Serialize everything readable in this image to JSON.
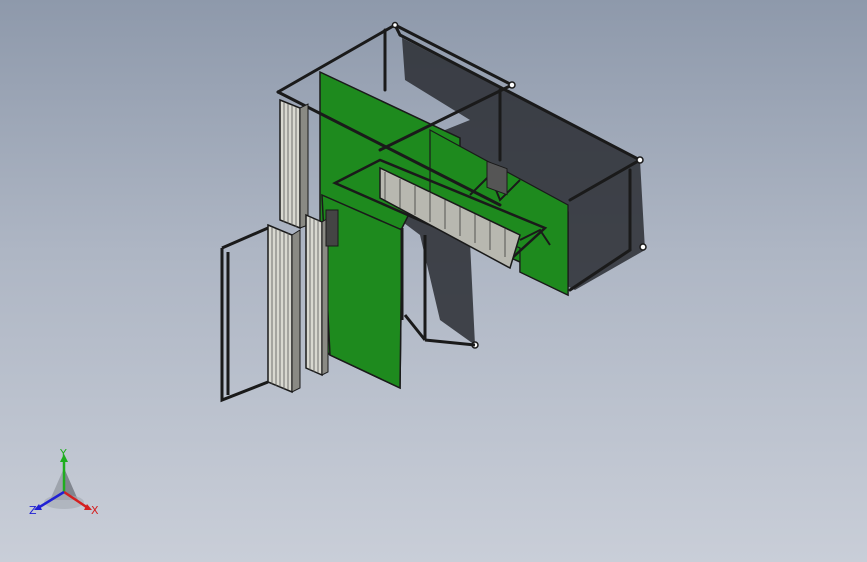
{
  "viewport": {
    "background_top": "#8e99ab",
    "background_bottom": "#c9ced8"
  },
  "model": {
    "panel_color": "#1e8a1e",
    "frame_color": "#1a1a1a",
    "shadow_color": "#2a2d33",
    "grill_color": "#b8b8b0"
  },
  "triad": {
    "x_label": "X",
    "y_label": "Y",
    "z_label": "Z",
    "x_color": "#d42020",
    "y_color": "#1fae1f",
    "z_color": "#2020d4"
  }
}
